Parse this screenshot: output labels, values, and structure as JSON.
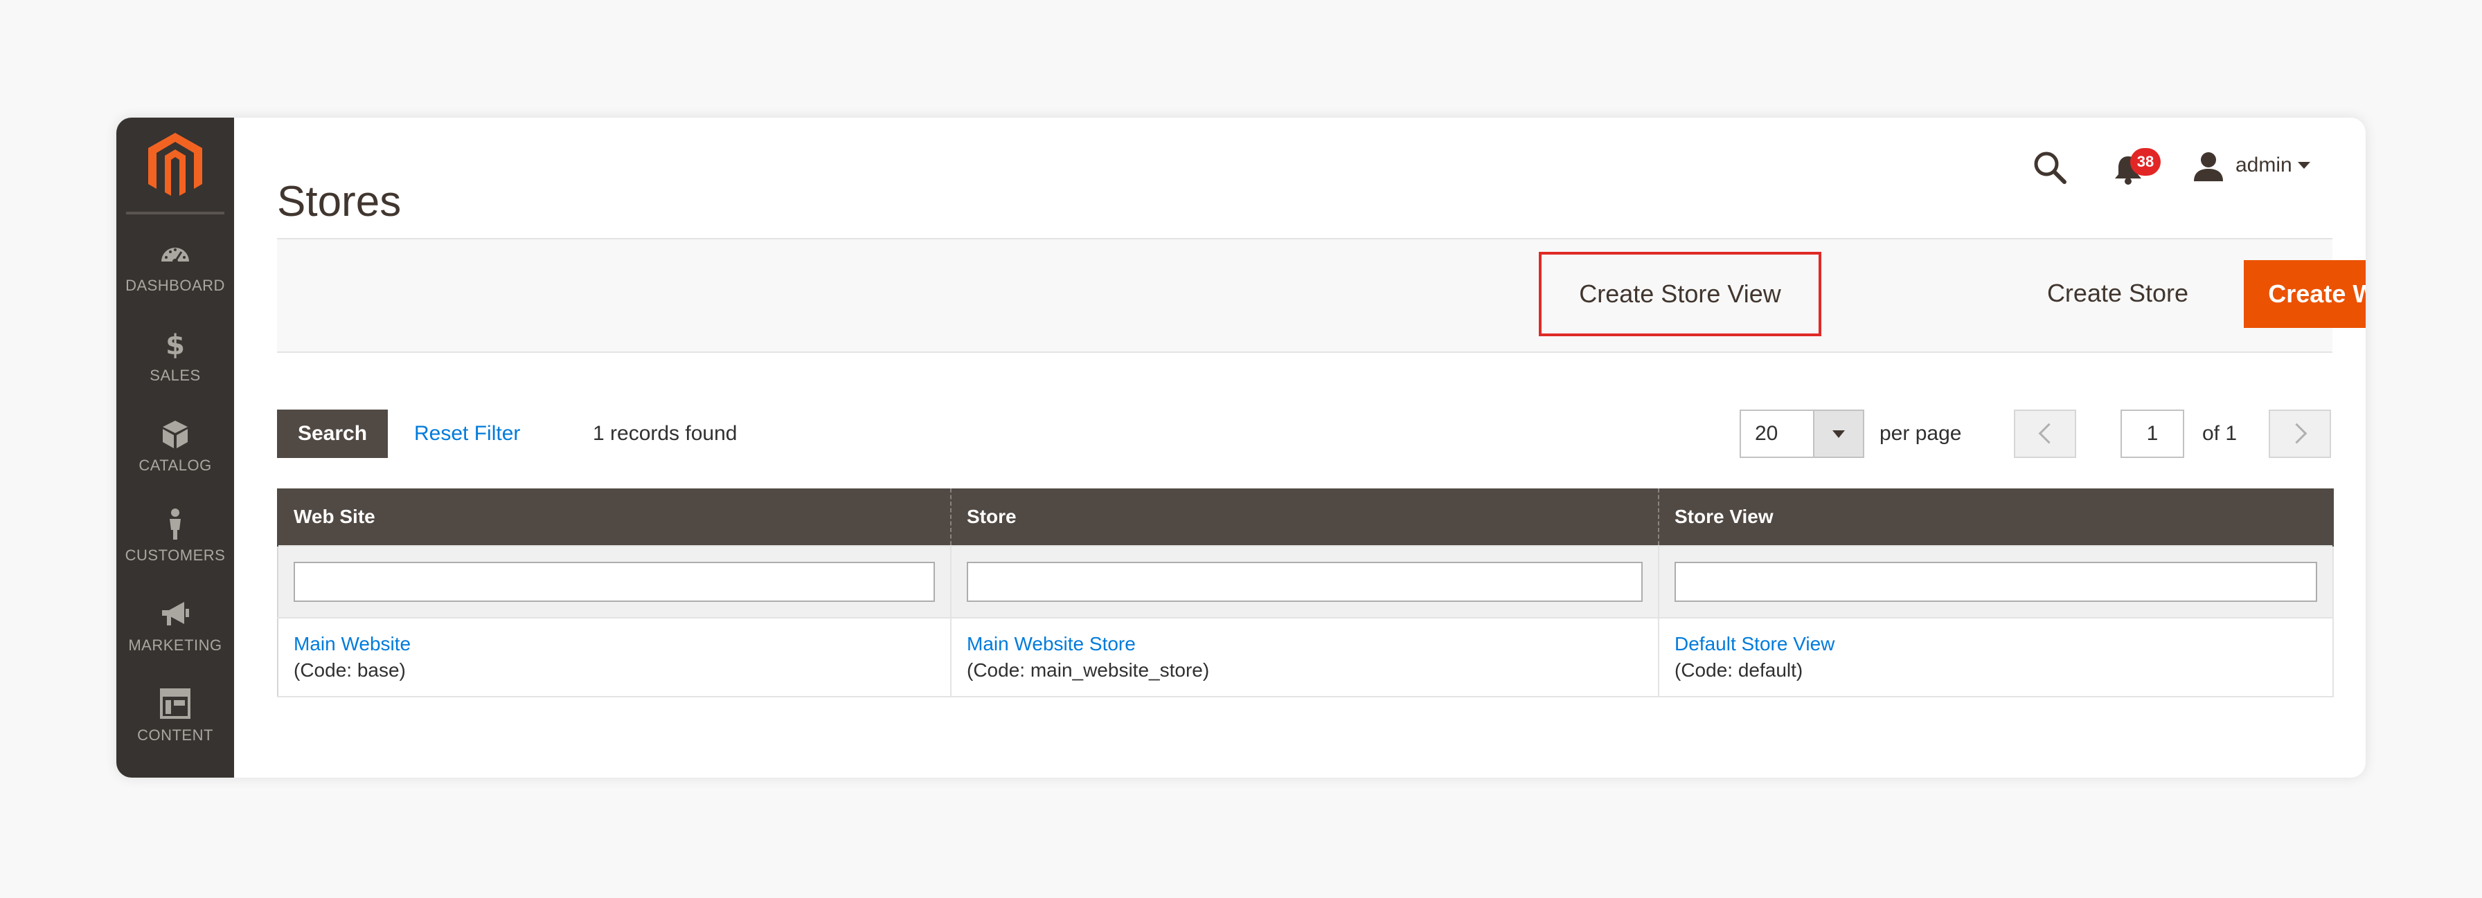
{
  "sidebar": {
    "items": [
      {
        "label": "DASHBOARD",
        "icon": "speedometer-icon"
      },
      {
        "label": "SALES",
        "icon": "dollar-icon"
      },
      {
        "label": "CATALOG",
        "icon": "box-icon"
      },
      {
        "label": "CUSTOMERS",
        "icon": "person-icon"
      },
      {
        "label": "MARKETING",
        "icon": "megaphone-icon"
      },
      {
        "label": "CONTENT",
        "icon": "layout-icon"
      }
    ]
  },
  "header": {
    "title": "Stores",
    "notification_count": "38",
    "user_name": "admin"
  },
  "actions": {
    "create_store_view": "Create Store View",
    "create_store": "Create Store",
    "create_website": "Create Website"
  },
  "toolbar": {
    "search_label": "Search",
    "reset_filter_label": "Reset Filter",
    "records_found": "1 records found",
    "per_page_value": "20",
    "per_page_label": "per page",
    "current_page": "1",
    "of_pages": "of 1"
  },
  "grid": {
    "columns": [
      "Web Site",
      "Store",
      "Store View"
    ],
    "rows": [
      {
        "website": {
          "name": "Main Website",
          "code": "(Code: base)"
        },
        "store": {
          "name": "Main Website Store",
          "code": "(Code: main_website_store)"
        },
        "store_view": {
          "name": "Default Store View",
          "code": "(Code: default)"
        }
      }
    ]
  },
  "colors": {
    "accent": "#eb5202",
    "sidebar_bg": "#373330",
    "header_row_bg": "#514943",
    "link": "#007bdb",
    "highlight_border": "#e02b27",
    "badge": "#e22626"
  }
}
